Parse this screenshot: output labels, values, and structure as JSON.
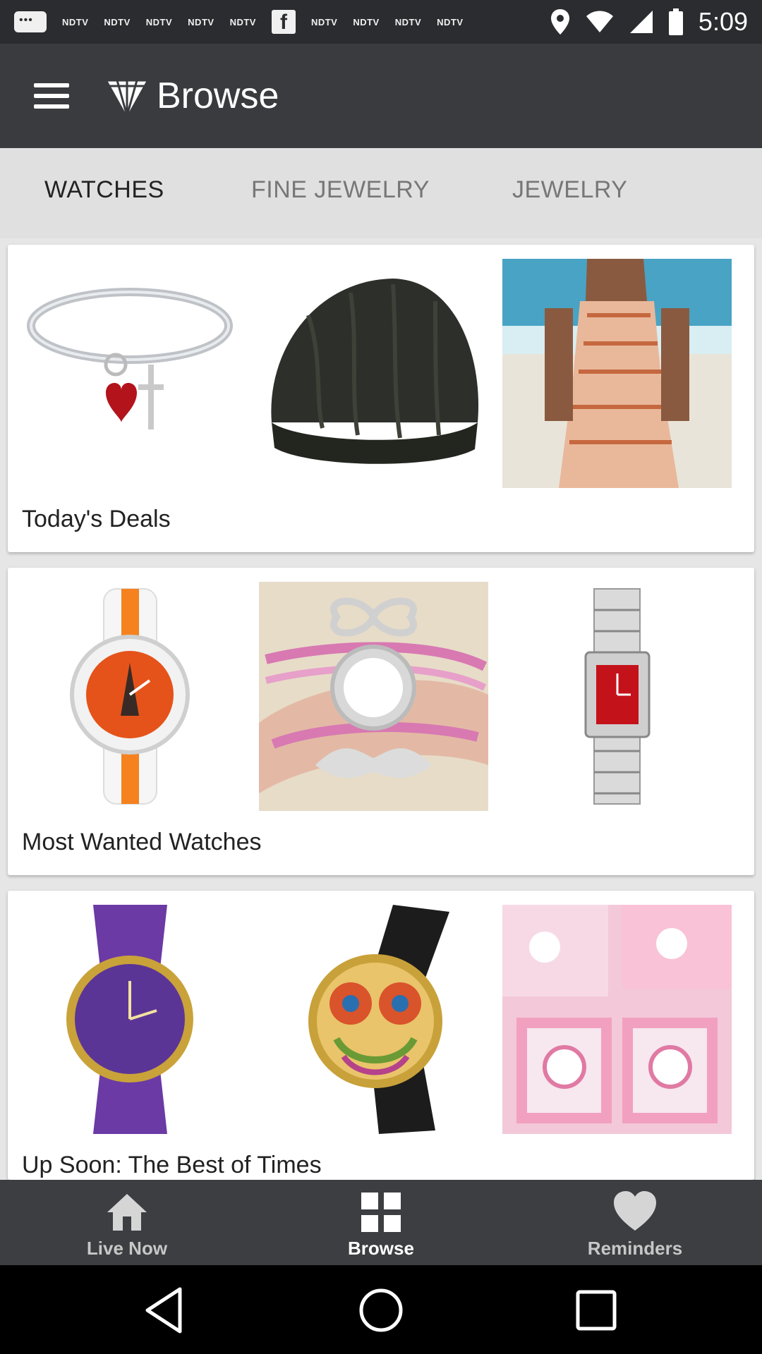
{
  "status_bar": {
    "notifications": [
      "NDTV",
      "NDTV",
      "NDTV",
      "NDTV",
      "NDTV",
      "NDTV",
      "NDTV",
      "NDTV",
      "NDTV"
    ],
    "time": "5:09"
  },
  "app_bar": {
    "title": "Browse"
  },
  "tabs": [
    {
      "label": "WATCHES",
      "active": true
    },
    {
      "label": "FINE JEWELRY",
      "active": false
    },
    {
      "label": "JEWELRY",
      "active": false
    }
  ],
  "cards": [
    {
      "title": "Today's Deals",
      "images": [
        "charm-bracelet-image",
        "knit-beanie-image",
        "romper-model-image"
      ]
    },
    {
      "title": "Most Wanted Watches",
      "images": [
        "orange-watch-image",
        "infinity-bracelet-watch-image",
        "silver-red-watch-image"
      ]
    },
    {
      "title": "Up Soon: The Best of Times",
      "images": [
        "purple-watch-image",
        "owl-watch-image",
        "hello-kitty-watch-set-image"
      ]
    }
  ],
  "bottom_nav": [
    {
      "label": "Live Now",
      "icon": "home-icon"
    },
    {
      "label": "Browse",
      "icon": "grid-icon"
    },
    {
      "label": "Reminders",
      "icon": "heart-icon"
    }
  ],
  "system_nav": [
    "back-icon",
    "home-circle-icon",
    "recents-icon"
  ]
}
